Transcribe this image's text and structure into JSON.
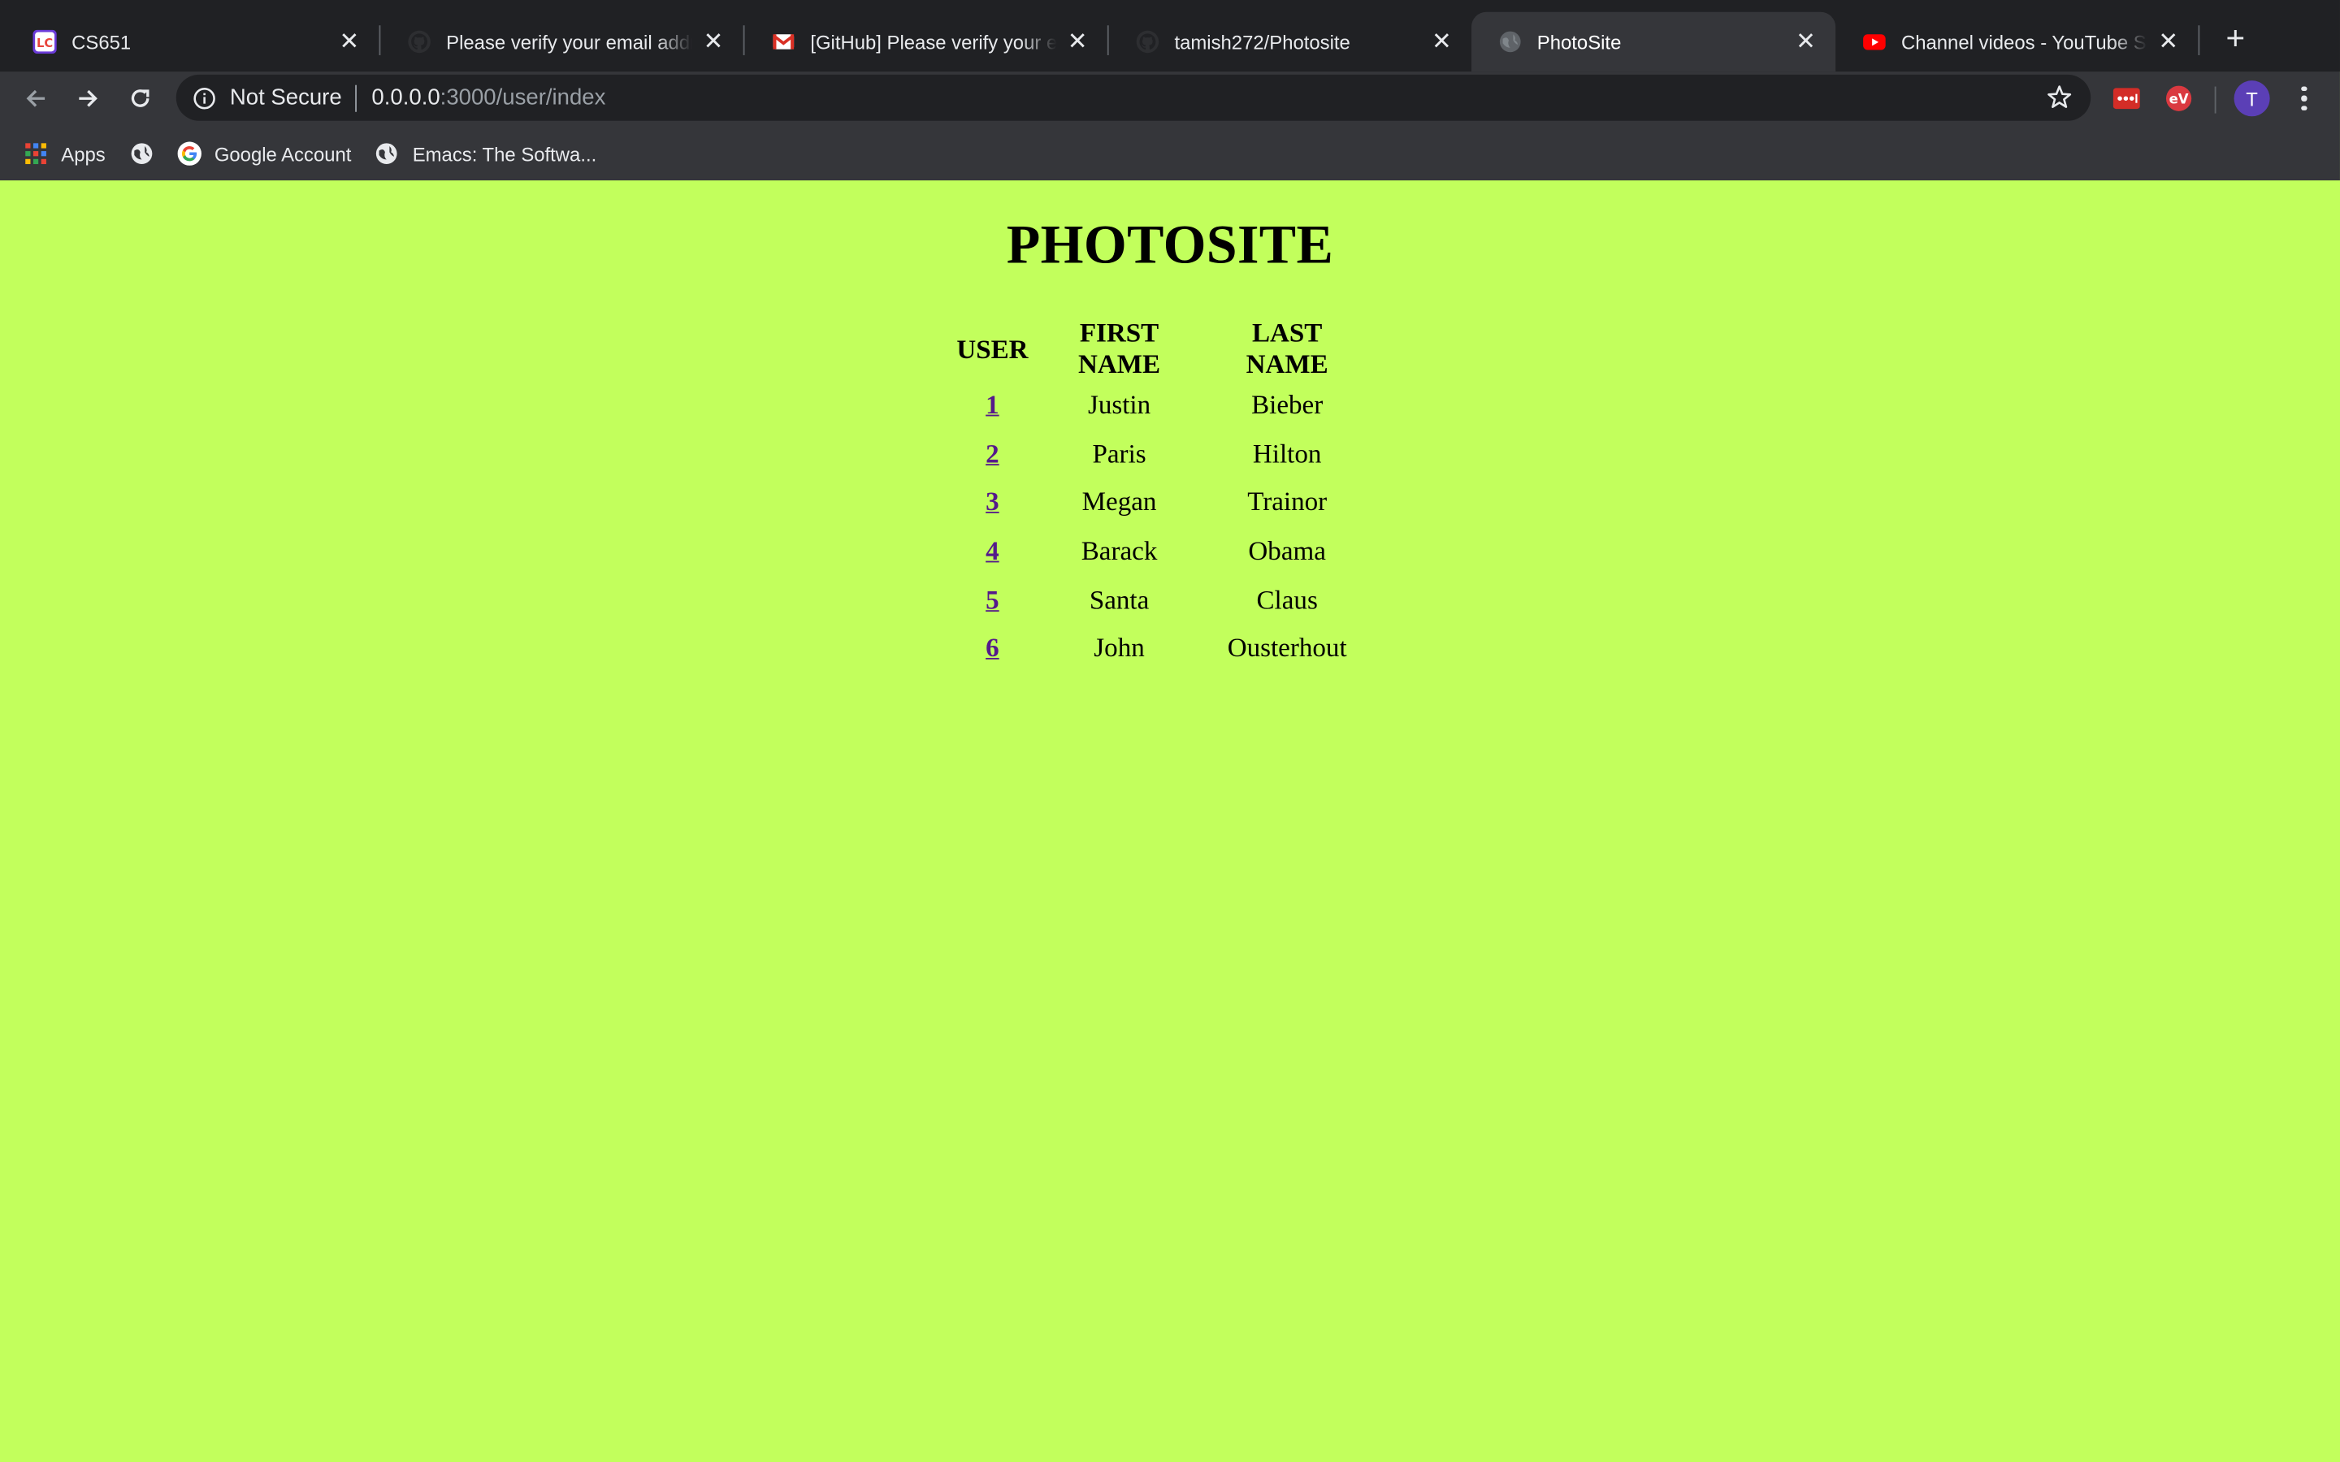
{
  "tabs": [
    {
      "title": "CS651",
      "favicon": "leetcode-icon",
      "active": false
    },
    {
      "title": "Please verify your email address",
      "favicon": "github-icon",
      "active": false
    },
    {
      "title": "[GitHub] Please verify your email",
      "favicon": "gmail-icon",
      "active": false
    },
    {
      "title": "tamish272/Photosite",
      "favicon": "github-icon",
      "active": false
    },
    {
      "title": "PhotoSite",
      "favicon": "globe-icon",
      "active": true
    },
    {
      "title": "Channel videos - YouTube Studio",
      "favicon": "youtube-icon",
      "active": false
    }
  ],
  "address_bar": {
    "security_label": "Not Secure",
    "host": "0.0.0.0",
    "path": ":3000/user/index"
  },
  "profile": {
    "initial": "T"
  },
  "bookmarks": [
    {
      "label": "Apps",
      "icon": "apps-grid-icon"
    },
    {
      "label": "",
      "icon": "globe-icon"
    },
    {
      "label": "Google Account",
      "icon": "google-icon"
    },
    {
      "label": "Emacs: The Softwa...",
      "icon": "globe-icon"
    }
  ],
  "page": {
    "background": "#c2ff5c",
    "heading": "PHOTOSITE",
    "table": {
      "headers": [
        "USER",
        "FIRST NAME",
        "LAST NAME"
      ],
      "rows": [
        {
          "id": "1",
          "first": "Justin",
          "last": "Bieber"
        },
        {
          "id": "2",
          "first": "Paris",
          "last": "Hilton"
        },
        {
          "id": "3",
          "first": "Megan",
          "last": "Trainor"
        },
        {
          "id": "4",
          "first": "Barack",
          "last": "Obama"
        },
        {
          "id": "5",
          "first": "Santa",
          "last": "Claus"
        },
        {
          "id": "6",
          "first": "John",
          "last": "Ousterhout"
        }
      ]
    }
  }
}
